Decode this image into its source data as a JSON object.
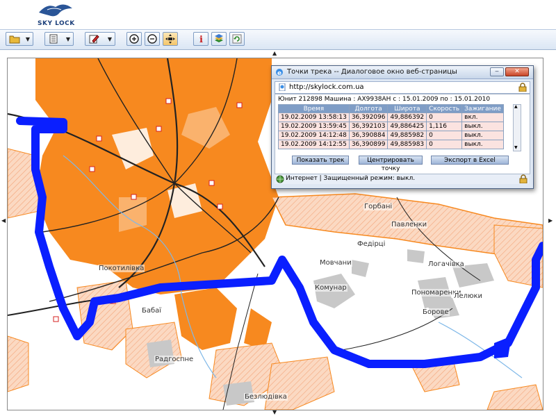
{
  "header": {
    "logo_text": "SKY LOCK"
  },
  "toolbar": {
    "buttons": [
      {
        "name": "open-menu-button",
        "icon": "folder-icon"
      },
      {
        "name": "list-menu-button",
        "icon": "document-icon"
      },
      {
        "name": "edit-menu-button",
        "icon": "pencil-icon"
      },
      {
        "name": "zoom-in-button",
        "icon": "zoom-in-icon"
      },
      {
        "name": "zoom-out-button",
        "icon": "zoom-out-icon"
      },
      {
        "name": "pan-button",
        "icon": "move-icon"
      },
      {
        "name": "info-button",
        "icon": "info-icon"
      },
      {
        "name": "layers-button",
        "icon": "layers-icon"
      },
      {
        "name": "refresh-button",
        "icon": "refresh-icon"
      }
    ]
  },
  "map": {
    "labels": [
      "Горбані",
      "Павленки",
      "Федірці",
      "Мовчани",
      "Логачівка",
      "Покотилівка",
      "Комунар",
      "Пономаренки",
      "Лелюки",
      "Борове",
      "Бабаї",
      "Радгоспне",
      "Безлюдівка"
    ],
    "colors": {
      "urban": "#f7891f",
      "residential": "#f9c7a8",
      "track": "#0a1fff",
      "road": "#222222"
    }
  },
  "dialog": {
    "title": "Точки трека -- Диалоговое окно веб-страницы",
    "address": "http://skylock.com.ua",
    "info": "Юнит 212898 Машина : AX9938AH с : 15.01.2009 по : 15.01.2010",
    "columns": [
      "Время",
      "Долгота",
      "Широта",
      "Скорость",
      "Зажигание"
    ],
    "rows": [
      [
        "19.02.2009 13:58:13",
        "36,392096",
        "49,886392",
        "0",
        "вкл."
      ],
      [
        "19.02.2009 13:59:45",
        "36,392103",
        "49,886425",
        "1,116",
        "выкл."
      ],
      [
        "19.02.2009 14:12:48",
        "36,390884",
        "49,885982",
        "0",
        "выкл."
      ],
      [
        "19.02.2009 14:12:55",
        "36,390899",
        "49,885983",
        "0",
        "выкл."
      ]
    ],
    "buttons": {
      "show_track": "Показать трек",
      "center_point": "Центрировать точку",
      "export_excel": "Экспорт в Excel"
    },
    "status": "Интернет | Защищенный режим: выкл."
  }
}
